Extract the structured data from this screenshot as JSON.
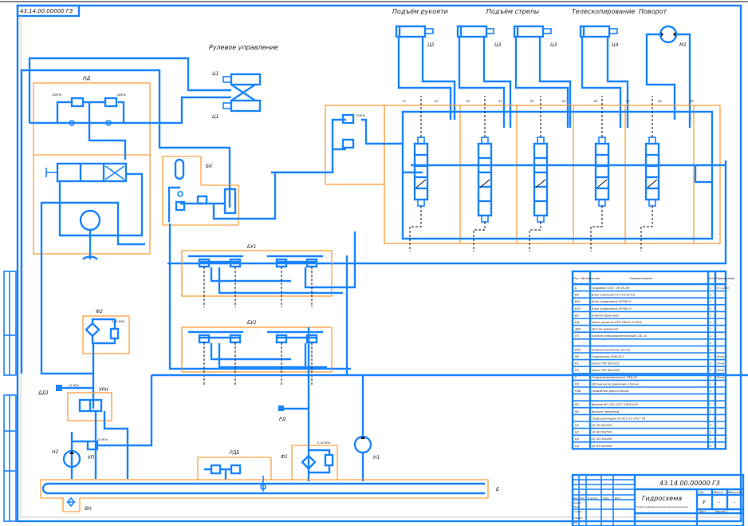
{
  "drawing": {
    "stamp_code": "43.14.00.00000 ГЗ",
    "section_labels": {
      "steering": "Рулевое управление",
      "arm_lift": "Подъём рукояти",
      "boom_lift": "Подъём стрелы",
      "telescoping": "Телескопирование",
      "rotation": "Поворот"
    },
    "components": {
      "c1_top": "Ц1",
      "c1_bottom": "Ц1",
      "c2": "Ц2",
      "c3a": "Ц3",
      "c3b": "Ц3",
      "c4": "Ц4",
      "m1": "М1",
      "nd": "НД",
      "bk": "БК",
      "bu1": "БУ1",
      "bu2": "БУ2",
      "f2": "Ф2",
      "urn": "УРН",
      "dd1": "ДД1",
      "n2": "Н2",
      "up": "УП",
      "rdb": "РДБ",
      "f1": "Ф1",
      "n1": "Н1",
      "tank": "Б",
      "vn": "ВН",
      "rd": "РД"
    },
    "pressures": {
      "nd_left": "16МПа",
      "nd_right": "16МПа",
      "valve_block": "22МПа",
      "f2": "0,35 МПа",
      "dd1": "15 МПа",
      "up": "18 МПа",
      "f1": "0,35 МПа"
    },
    "port_labels": [
      "Р1",
      "А2",
      "В2",
      "А3",
      "В3",
      "А4",
      "В4",
      "Р7",
      "А8",
      "В8"
    ]
  },
  "parts_list": {
    "headers": [
      "Поз. обозначение",
      "Наименование",
      "Кол.",
      "Примечание"
    ],
    "rows": [
      [
        "Б",
        "Гидробак ГОСТ 16770-86",
        "1",
        "V=120л"
      ],
      [
        "БК",
        "Блок клапанов ГСЧ 54-52-5А",
        "1",
        ""
      ],
      [
        "БУ1",
        "Блок управления ЗРЛМ-01",
        "1",
        ""
      ],
      [
        "БУ2",
        "Блок управления ЗРЛМ-02",
        "1",
        ""
      ],
      [
        "БК",
        "Клапан обратный",
        "1",
        ""
      ],
      [
        "НД",
        "Насос-дозатор ОРЗ 160-Б-10 ЗОА",
        "1",
        ""
      ],
      [
        "ДД1",
        "Датчик давления",
        "1",
        ""
      ],
      [
        "УП",
        "Клапан предохранительный 5-4Е-25",
        "1",
        ""
      ],
      [
        "",
        "",
        "1",
        ""
      ],
      [
        "УРН",
        "Клапан разгрузки насоса",
        "1",
        ""
      ],
      [
        "М1",
        "Гидромотор ЗНМ-Б12",
        "1",
        "Зона"
      ],
      [
        "Н1",
        "Насос РЗР 6х0,035",
        "1",
        "Зона"
      ],
      [
        "Н2",
        "Насос РЗР 6х0,035",
        "1",
        "Зона"
      ],
      [
        "Р",
        "Гидрораспределитель РЗД-05",
        "1",
        "Зона"
      ],
      [
        "РД",
        "Датчик-реле давления в блоке",
        "1",
        ""
      ],
      [
        "РДБ",
        "Гидроблок дроссельный",
        "1",
        ""
      ],
      [
        "",
        "",
        "",
        ""
      ],
      [
        "Ф1",
        "Фильтр ФГ-250 ГОСТ 16026-80",
        "1",
        ""
      ],
      [
        "Ф2",
        "Фильтр напорный",
        "1",
        ""
      ],
      [
        "",
        "Гидроцилиндры по ОСТ 22-1417-79",
        "",
        ""
      ],
      [
        "Ц1",
        "ЦГ-50.32х250",
        "1",
        ""
      ],
      [
        "Ц2",
        "ЦГ-80.50х500",
        "1",
        ""
      ],
      [
        "Ц3",
        "ЦГ-80.50х400",
        "1",
        ""
      ],
      [
        "Ц4",
        "ЦГ-63.40х500",
        "1",
        ""
      ]
    ]
  },
  "title_block": {
    "doc_code": "43.14.00.00000 ГЗ",
    "title": "Гидросхема",
    "subtitle": "Схема гидравлическая принципиальная",
    "col_headers": [
      "Изм.",
      "Лист",
      "№ докум.",
      "Подп.",
      "Дата"
    ],
    "row_labels": [
      "Разраб.",
      "Пров.",
      "Т.контр.",
      "Н.контр.",
      "Утв."
    ],
    "lit_label": "Лит.",
    "mass_label": "Масса",
    "scale_label": "Масштаб",
    "mass_value": "-",
    "scale_value": "-",
    "sheet_label": "Лист",
    "sheets_label": "Листов 1",
    "lit_value": "У"
  },
  "colors": {
    "lines": "#1a84ff",
    "blocks": "#ff8c1a",
    "text": "#222222"
  }
}
